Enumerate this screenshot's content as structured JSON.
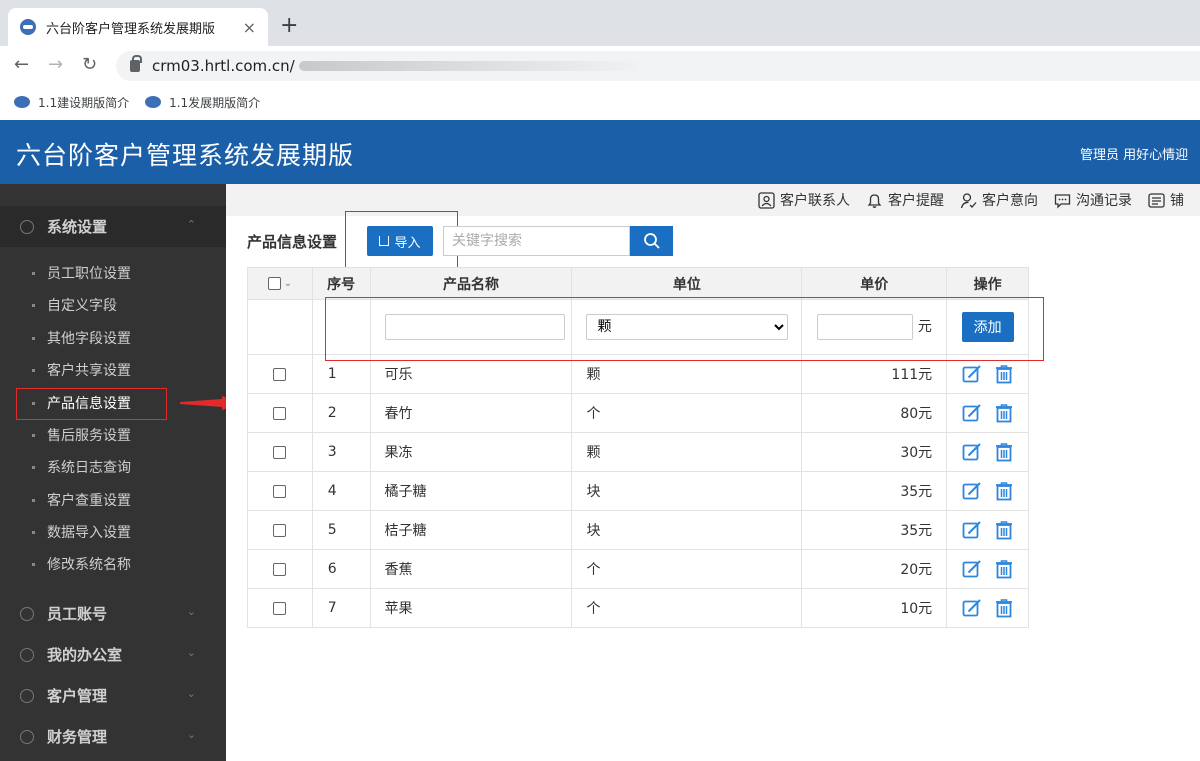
{
  "browser": {
    "tab_title": "六台阶客户管理系统发展期版",
    "tab_close": "×",
    "new_tab": "+",
    "url": "crm03.hrtl.com.cn/",
    "bookmarks": [
      {
        "label": "1.1建设期版简介"
      },
      {
        "label": "1.1发展期版简介"
      }
    ]
  },
  "header": {
    "title": "六台阶客户管理系统发展期版",
    "user_text": "管理员  用好心情迎"
  },
  "sidebar": {
    "groups": [
      {
        "label": "系统设置",
        "expanded": true
      },
      {
        "label": "员工账号"
      },
      {
        "label": "我的办公室"
      },
      {
        "label": "客户管理"
      },
      {
        "label": "财务管理"
      }
    ],
    "items": [
      {
        "label": "员工职位设置"
      },
      {
        "label": "自定义字段"
      },
      {
        "label": "其他字段设置"
      },
      {
        "label": "客户共享设置"
      },
      {
        "label": "产品信息设置",
        "selected": true
      },
      {
        "label": "售后服务设置"
      },
      {
        "label": "系统日志查询"
      },
      {
        "label": "客户查重设置"
      },
      {
        "label": "数据导入设置"
      },
      {
        "label": "修改系统名称"
      }
    ]
  },
  "toolbar": {
    "items": [
      {
        "label": "客户联系人",
        "icon": "contact-icon"
      },
      {
        "label": "客户提醒",
        "icon": "bell-icon"
      },
      {
        "label": "客户意向",
        "icon": "user-intent-icon"
      },
      {
        "label": "沟通记录",
        "icon": "chat-icon"
      },
      {
        "label": "铺",
        "icon": "more-icon"
      }
    ]
  },
  "main": {
    "section_title": "产品信息设置",
    "import_label": "导入",
    "search_placeholder": "关键字搜索",
    "table": {
      "headers": [
        "序号",
        "产品名称",
        "单位",
        "单价",
        "操作"
      ],
      "add_row": {
        "name_value": "",
        "unit_selected": "颗",
        "price_value": "",
        "price_suffix": "元",
        "add_label": "添加"
      },
      "rows": [
        {
          "index": "1",
          "name": "可乐",
          "unit": "颗",
          "price": "111元"
        },
        {
          "index": "2",
          "name": "春竹",
          "unit": "个",
          "price": "80元"
        },
        {
          "index": "3",
          "name": "果冻",
          "unit": "颗",
          "price": "30元"
        },
        {
          "index": "4",
          "name": "橘子糖",
          "unit": "块",
          "price": "35元"
        },
        {
          "index": "5",
          "name": "桔子糖",
          "unit": "块",
          "price": "35元"
        },
        {
          "index": "6",
          "name": "香蕉",
          "unit": "个",
          "price": "20元"
        },
        {
          "index": "7",
          "name": "苹果",
          "unit": "个",
          "price": "10元"
        }
      ]
    }
  },
  "colors": {
    "header_bg": "#1b5fa8",
    "primary": "#1b6fc2",
    "sidebar_bg": "#333333",
    "highlight": "#e12b2b"
  }
}
